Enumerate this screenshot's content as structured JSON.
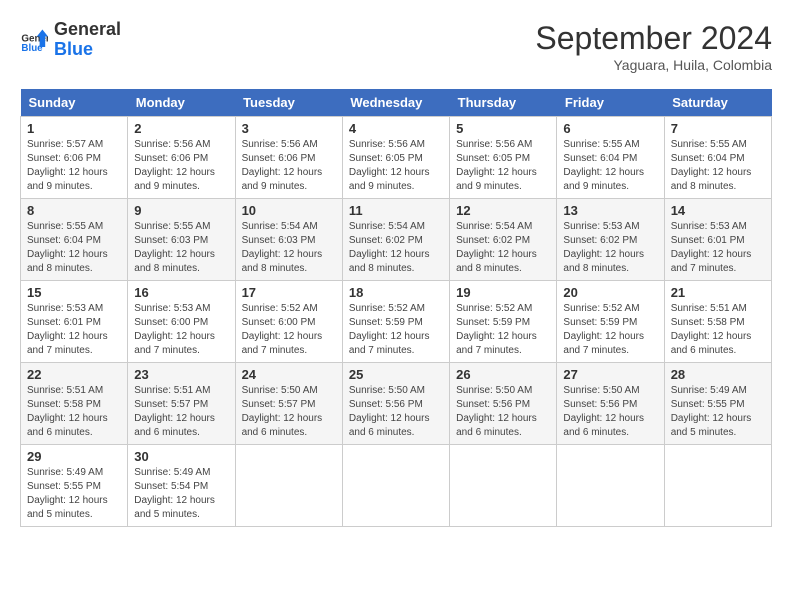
{
  "header": {
    "logo_line1": "General",
    "logo_line2": "Blue",
    "month_title": "September 2024",
    "location": "Yaguara, Huila, Colombia"
  },
  "weekdays": [
    "Sunday",
    "Monday",
    "Tuesday",
    "Wednesday",
    "Thursday",
    "Friday",
    "Saturday"
  ],
  "weeks": [
    [
      {
        "day": "1",
        "sunrise": "Sunrise: 5:57 AM",
        "sunset": "Sunset: 6:06 PM",
        "daylight": "Daylight: 12 hours and 9 minutes."
      },
      {
        "day": "2",
        "sunrise": "Sunrise: 5:56 AM",
        "sunset": "Sunset: 6:06 PM",
        "daylight": "Daylight: 12 hours and 9 minutes."
      },
      {
        "day": "3",
        "sunrise": "Sunrise: 5:56 AM",
        "sunset": "Sunset: 6:06 PM",
        "daylight": "Daylight: 12 hours and 9 minutes."
      },
      {
        "day": "4",
        "sunrise": "Sunrise: 5:56 AM",
        "sunset": "Sunset: 6:05 PM",
        "daylight": "Daylight: 12 hours and 9 minutes."
      },
      {
        "day": "5",
        "sunrise": "Sunrise: 5:56 AM",
        "sunset": "Sunset: 6:05 PM",
        "daylight": "Daylight: 12 hours and 9 minutes."
      },
      {
        "day": "6",
        "sunrise": "Sunrise: 5:55 AM",
        "sunset": "Sunset: 6:04 PM",
        "daylight": "Daylight: 12 hours and 9 minutes."
      },
      {
        "day": "7",
        "sunrise": "Sunrise: 5:55 AM",
        "sunset": "Sunset: 6:04 PM",
        "daylight": "Daylight: 12 hours and 8 minutes."
      }
    ],
    [
      {
        "day": "8",
        "sunrise": "Sunrise: 5:55 AM",
        "sunset": "Sunset: 6:04 PM",
        "daylight": "Daylight: 12 hours and 8 minutes."
      },
      {
        "day": "9",
        "sunrise": "Sunrise: 5:55 AM",
        "sunset": "Sunset: 6:03 PM",
        "daylight": "Daylight: 12 hours and 8 minutes."
      },
      {
        "day": "10",
        "sunrise": "Sunrise: 5:54 AM",
        "sunset": "Sunset: 6:03 PM",
        "daylight": "Daylight: 12 hours and 8 minutes."
      },
      {
        "day": "11",
        "sunrise": "Sunrise: 5:54 AM",
        "sunset": "Sunset: 6:02 PM",
        "daylight": "Daylight: 12 hours and 8 minutes."
      },
      {
        "day": "12",
        "sunrise": "Sunrise: 5:54 AM",
        "sunset": "Sunset: 6:02 PM",
        "daylight": "Daylight: 12 hours and 8 minutes."
      },
      {
        "day": "13",
        "sunrise": "Sunrise: 5:53 AM",
        "sunset": "Sunset: 6:02 PM",
        "daylight": "Daylight: 12 hours and 8 minutes."
      },
      {
        "day": "14",
        "sunrise": "Sunrise: 5:53 AM",
        "sunset": "Sunset: 6:01 PM",
        "daylight": "Daylight: 12 hours and 7 minutes."
      }
    ],
    [
      {
        "day": "15",
        "sunrise": "Sunrise: 5:53 AM",
        "sunset": "Sunset: 6:01 PM",
        "daylight": "Daylight: 12 hours and 7 minutes."
      },
      {
        "day": "16",
        "sunrise": "Sunrise: 5:53 AM",
        "sunset": "Sunset: 6:00 PM",
        "daylight": "Daylight: 12 hours and 7 minutes."
      },
      {
        "day": "17",
        "sunrise": "Sunrise: 5:52 AM",
        "sunset": "Sunset: 6:00 PM",
        "daylight": "Daylight: 12 hours and 7 minutes."
      },
      {
        "day": "18",
        "sunrise": "Sunrise: 5:52 AM",
        "sunset": "Sunset: 5:59 PM",
        "daylight": "Daylight: 12 hours and 7 minutes."
      },
      {
        "day": "19",
        "sunrise": "Sunrise: 5:52 AM",
        "sunset": "Sunset: 5:59 PM",
        "daylight": "Daylight: 12 hours and 7 minutes."
      },
      {
        "day": "20",
        "sunrise": "Sunrise: 5:52 AM",
        "sunset": "Sunset: 5:59 PM",
        "daylight": "Daylight: 12 hours and 7 minutes."
      },
      {
        "day": "21",
        "sunrise": "Sunrise: 5:51 AM",
        "sunset": "Sunset: 5:58 PM",
        "daylight": "Daylight: 12 hours and 6 minutes."
      }
    ],
    [
      {
        "day": "22",
        "sunrise": "Sunrise: 5:51 AM",
        "sunset": "Sunset: 5:58 PM",
        "daylight": "Daylight: 12 hours and 6 minutes."
      },
      {
        "day": "23",
        "sunrise": "Sunrise: 5:51 AM",
        "sunset": "Sunset: 5:57 PM",
        "daylight": "Daylight: 12 hours and 6 minutes."
      },
      {
        "day": "24",
        "sunrise": "Sunrise: 5:50 AM",
        "sunset": "Sunset: 5:57 PM",
        "daylight": "Daylight: 12 hours and 6 minutes."
      },
      {
        "day": "25",
        "sunrise": "Sunrise: 5:50 AM",
        "sunset": "Sunset: 5:56 PM",
        "daylight": "Daylight: 12 hours and 6 minutes."
      },
      {
        "day": "26",
        "sunrise": "Sunrise: 5:50 AM",
        "sunset": "Sunset: 5:56 PM",
        "daylight": "Daylight: 12 hours and 6 minutes."
      },
      {
        "day": "27",
        "sunrise": "Sunrise: 5:50 AM",
        "sunset": "Sunset: 5:56 PM",
        "daylight": "Daylight: 12 hours and 6 minutes."
      },
      {
        "day": "28",
        "sunrise": "Sunrise: 5:49 AM",
        "sunset": "Sunset: 5:55 PM",
        "daylight": "Daylight: 12 hours and 5 minutes."
      }
    ],
    [
      {
        "day": "29",
        "sunrise": "Sunrise: 5:49 AM",
        "sunset": "Sunset: 5:55 PM",
        "daylight": "Daylight: 12 hours and 5 minutes."
      },
      {
        "day": "30",
        "sunrise": "Sunrise: 5:49 AM",
        "sunset": "Sunset: 5:54 PM",
        "daylight": "Daylight: 12 hours and 5 minutes."
      },
      null,
      null,
      null,
      null,
      null
    ]
  ]
}
